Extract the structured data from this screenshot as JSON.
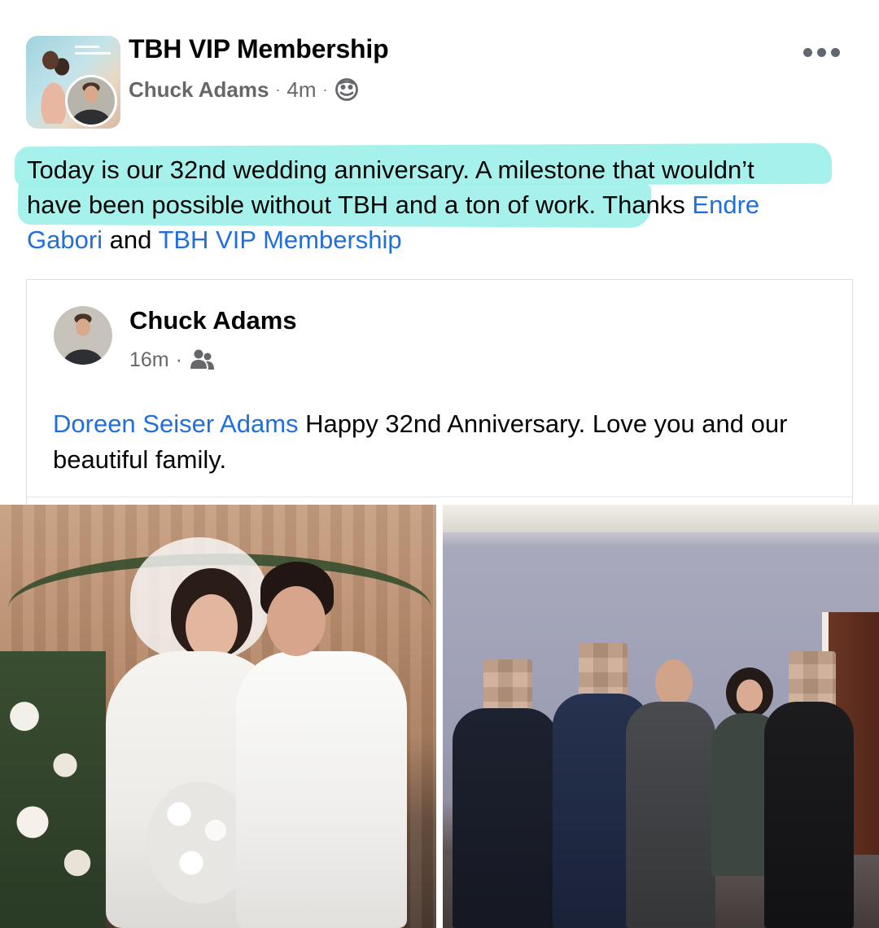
{
  "post": {
    "group_name": "TBH VIP Membership",
    "author": "Chuck Adams",
    "separator": "·",
    "time": "4m",
    "privacy_icon": "globe-icon",
    "more_icon": "more-options-icon",
    "text_highlighted_1": "Today is our 32nd wedding anniversary. A milestone that wouldn’t",
    "text_highlighted_2": "have been possible without TBH and a ton of work.",
    "text_after": " Thanks ",
    "mention_1": "Endre Gabori",
    "text_and": " and ",
    "mention_2": "TBH VIP Membership"
  },
  "shared_post": {
    "author": "Chuck Adams",
    "time": "16m",
    "separator": "·",
    "audience_icon": "friends-icon",
    "mention": "Doreen Seiser Adams",
    "text": " Happy 32nd Anniversary. Love you and our beautiful family."
  },
  "photos": [
    {
      "name": "wedding-photo"
    },
    {
      "name": "family-photo"
    }
  ],
  "colors": {
    "link": "#216fdb",
    "highlight": "#9df0ea",
    "meta_text": "#65676b",
    "primary_text": "#050505"
  }
}
